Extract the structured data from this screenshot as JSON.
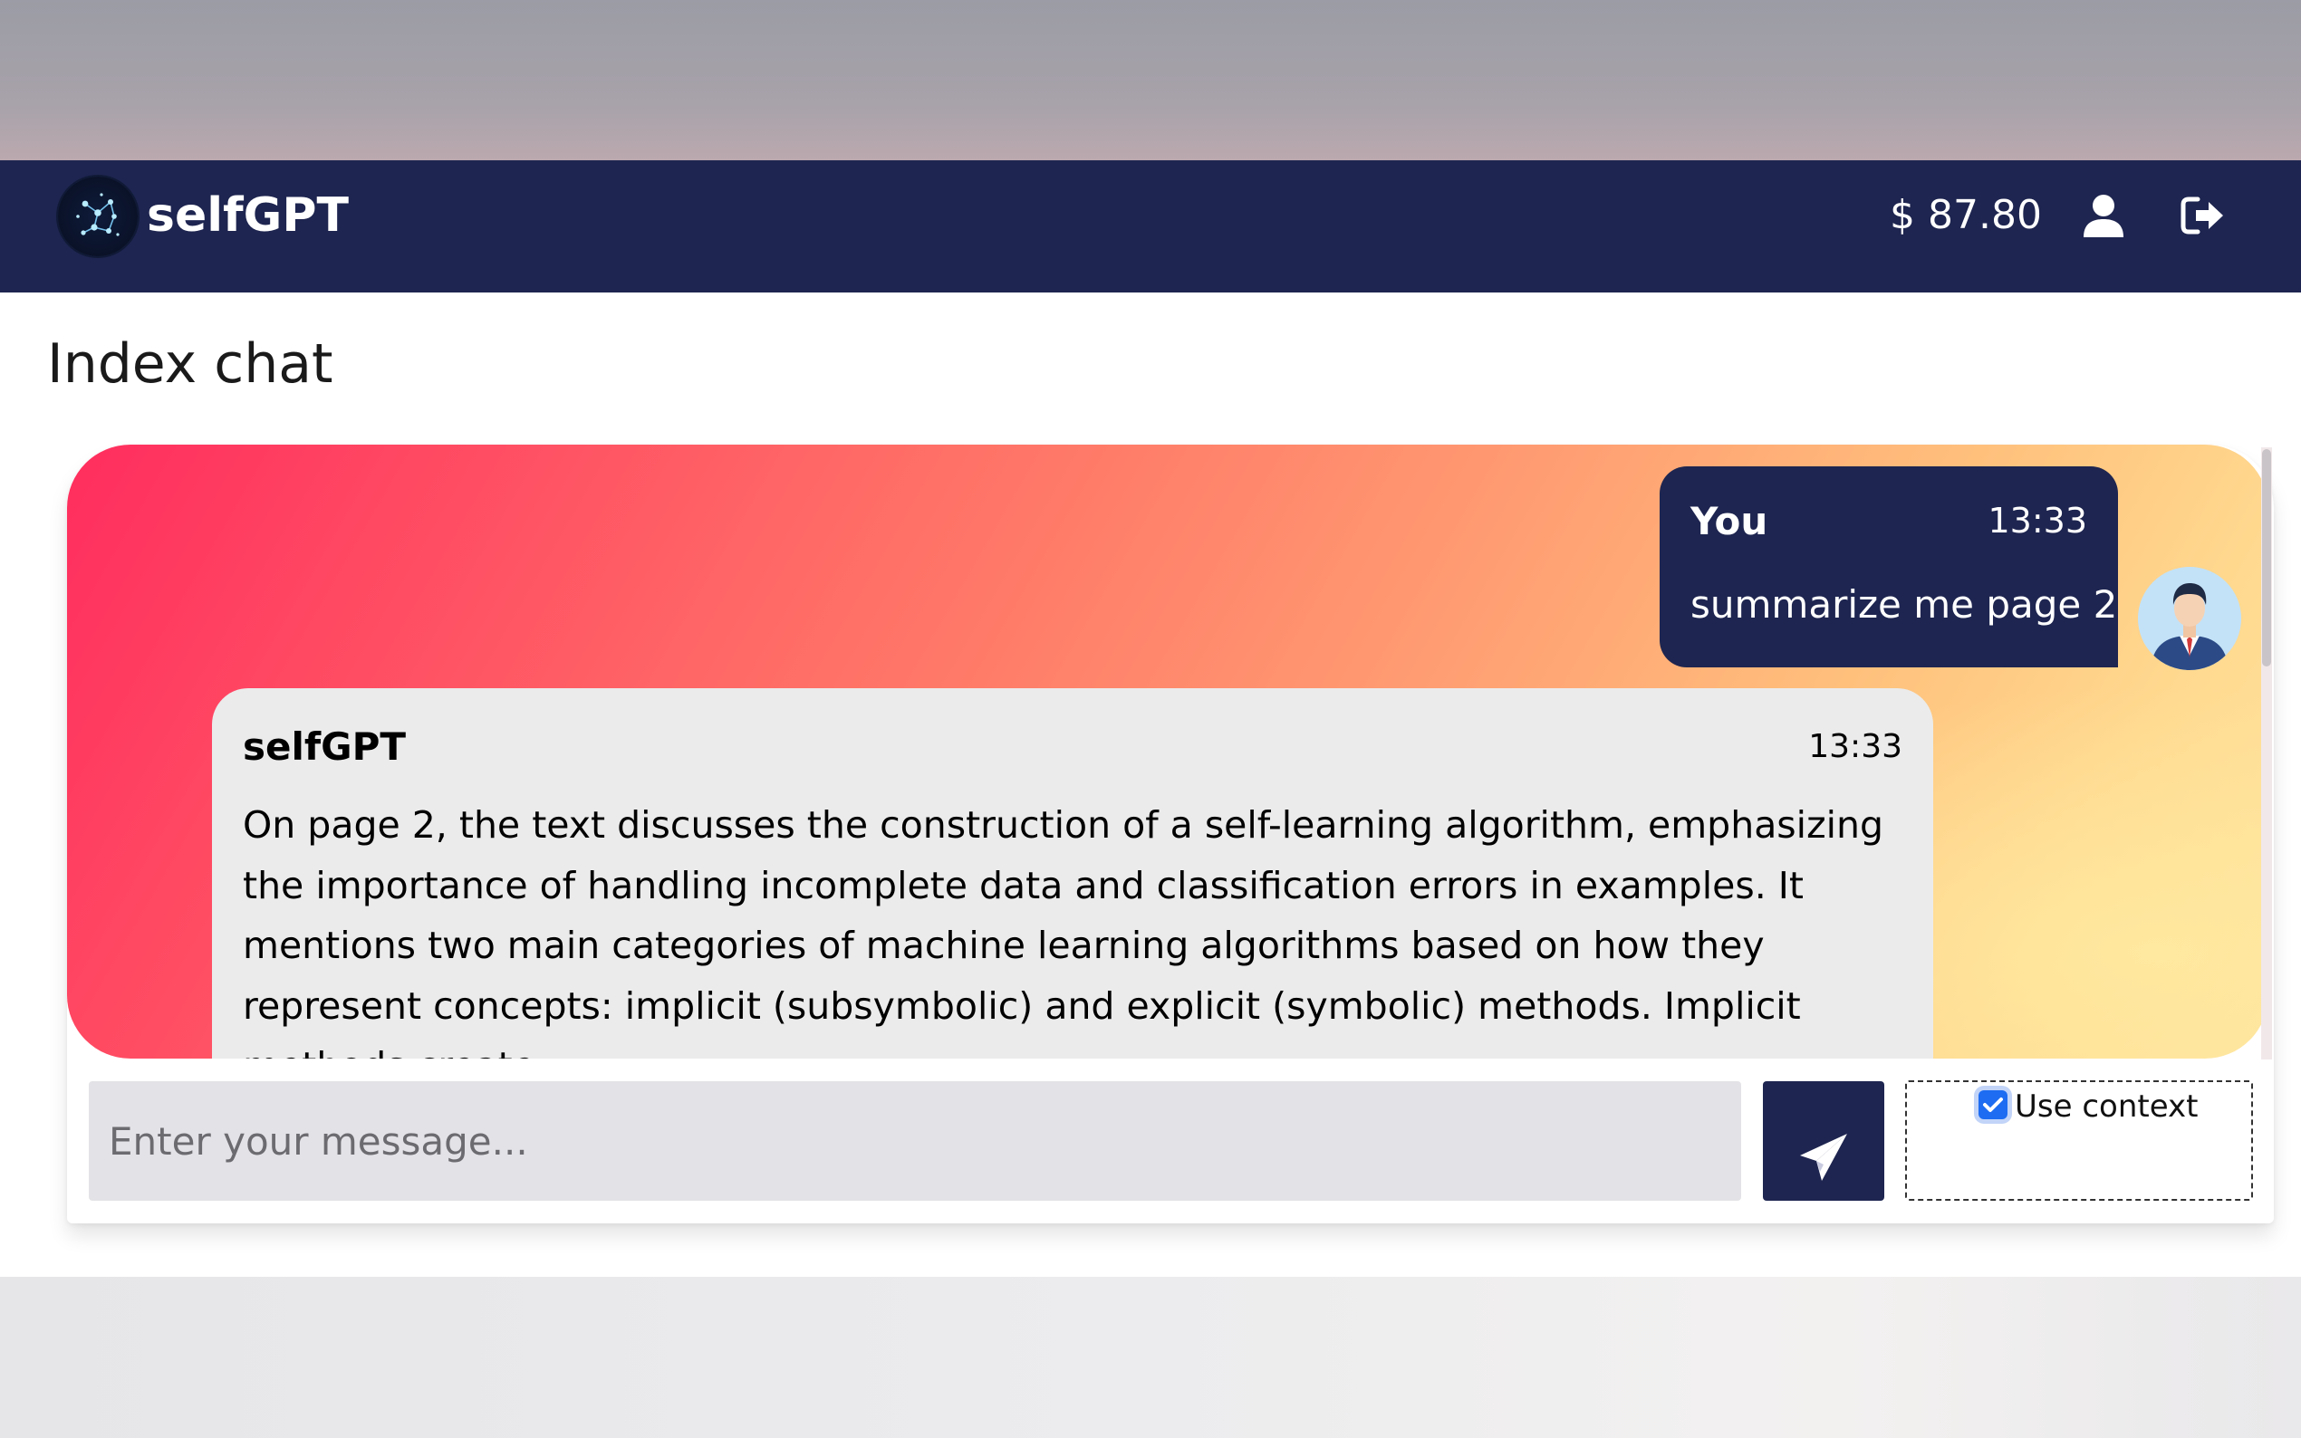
{
  "header": {
    "brand_name": "selfGPT",
    "balance": "$ 87.80",
    "icons": [
      "logo-icon",
      "user-icon",
      "logout-icon"
    ]
  },
  "page": {
    "title": "Index chat"
  },
  "messages": [
    {
      "sender": "You",
      "time": "13:33",
      "text": "summarize me page 2"
    },
    {
      "sender": "selfGPT",
      "time": "13:33",
      "text": "On page 2, the text discusses the construction of a self-learning algorithm, emphasizing the importance of handling incomplete data and classification errors in examples. It mentions two main categories of machine learning algorithms based on how they represent concepts: implicit (subsymbolic) and explicit (symbolic) methods. Implicit methods create"
    }
  ],
  "composer": {
    "placeholder": "Enter your message...",
    "value": "",
    "context_label": "Use context",
    "context_checked": true
  },
  "colors": {
    "navbar": "#1e2550",
    "accent": "#1d6cf2",
    "bubble_bot": "#ebebeb",
    "gradient_start": "#ff2d5e",
    "gradient_end": "#ffe4a0"
  }
}
